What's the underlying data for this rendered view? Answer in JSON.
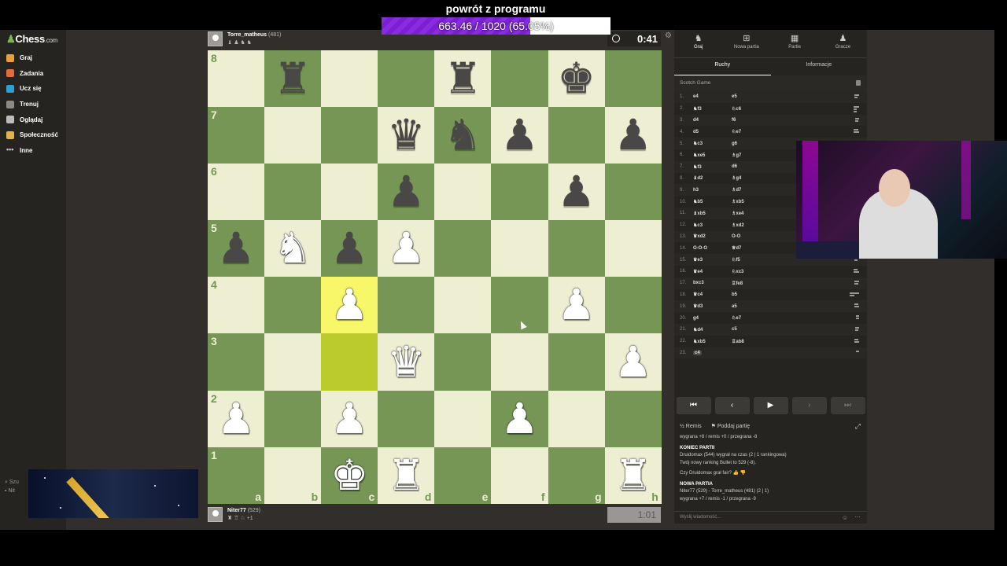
{
  "sidebar": {
    "logo": "Chess",
    "logo_suffix": ".com",
    "items": [
      {
        "label": "Graj",
        "icon": "play-icon",
        "color": "#e8a13a"
      },
      {
        "label": "Zadania",
        "icon": "puzzle-icon",
        "color": "#e36a3a"
      },
      {
        "label": "Ucz się",
        "icon": "learn-icon",
        "color": "#2b9fd6"
      },
      {
        "label": "Trenuj",
        "icon": "train-icon",
        "color": "#8d8a86"
      },
      {
        "label": "Oglądaj",
        "icon": "watch-icon",
        "color": "#bcbcbc"
      },
      {
        "label": "Społeczność",
        "icon": "community-icon",
        "color": "#ddb34a"
      },
      {
        "label": "Inne",
        "icon": "more-icon",
        "color": "#cccccc"
      }
    ],
    "bottom_search": "Szu",
    "bottom_user": "Nit"
  },
  "donation": {
    "title": "powrót z programu",
    "progress_text": "663.46 / 1020 (65.05%)",
    "progress": 0.6505
  },
  "players": {
    "top": {
      "name": "Torre_matheus",
      "rating": "(481)",
      "material": "♝ ♟ ♞ ♞",
      "clock": "0:41"
    },
    "bottom": {
      "name": "Niter77",
      "rating": "(529)",
      "material": "♜ ♖ ♘ +1",
      "clock": "1:01"
    }
  },
  "board": {
    "ranks": [
      "8",
      "7",
      "6",
      "5",
      "4",
      "3",
      "2",
      "1"
    ],
    "files": [
      "a",
      "b",
      "c",
      "d",
      "e",
      "f",
      "g",
      "h"
    ],
    "rows": [
      [
        "",
        "r",
        "",
        "",
        "r",
        "",
        "k",
        ""
      ],
      [
        "",
        "",
        "",
        "q",
        "n",
        "p",
        "",
        "p"
      ],
      [
        "",
        "",
        "",
        "p",
        "",
        "",
        "p",
        ""
      ],
      [
        "p",
        "N",
        "p",
        "P",
        "",
        "",
        "",
        ""
      ],
      [
        "",
        "",
        "P",
        "",
        "",
        "",
        "P",
        ""
      ],
      [
        "",
        "",
        "",
        "Q",
        "",
        "",
        "",
        "P"
      ],
      [
        "P",
        "",
        "P",
        "",
        "",
        "P",
        "",
        ""
      ],
      [
        "",
        "",
        "K",
        "R",
        "",
        "",
        "",
        "R"
      ]
    ],
    "highlight": [
      "c4",
      "c3"
    ]
  },
  "panel": {
    "tabs": [
      {
        "label": "Graj",
        "icon": "play-icon"
      },
      {
        "label": "Nowa partia",
        "icon": "plus-icon"
      },
      {
        "label": "Partie",
        "icon": "board-icon"
      },
      {
        "label": "Gracze",
        "icon": "players-icon"
      }
    ],
    "subtabs": [
      "Ruchy",
      "Informacje"
    ],
    "opening": "Scotch Game",
    "moves": [
      {
        "n": "1.",
        "w": "e4",
        "b": "e5"
      },
      {
        "n": "2.",
        "w": "♞f3",
        "b": "♘c6"
      },
      {
        "n": "3.",
        "w": "d4",
        "b": "f6"
      },
      {
        "n": "4.",
        "w": "d5",
        "b": "♘e7"
      },
      {
        "n": "5.",
        "w": "♞c3",
        "b": "g6"
      },
      {
        "n": "6.",
        "w": "♞xe5",
        "b": "♗g7"
      },
      {
        "n": "7.",
        "w": "♞f3",
        "b": "d6"
      },
      {
        "n": "8.",
        "w": "♝d2",
        "b": "♗g4"
      },
      {
        "n": "9.",
        "w": "h3",
        "b": "♗d7"
      },
      {
        "n": "10.",
        "w": "♞b5",
        "b": "♗xb5"
      },
      {
        "n": "11.",
        "w": "♝xb5",
        "b": "♗xe4"
      },
      {
        "n": "12.",
        "w": "♞c3",
        "b": "♗xd2"
      },
      {
        "n": "13.",
        "w": "♛xd2",
        "b": "O-O"
      },
      {
        "n": "14.",
        "w": "O-O-O",
        "b": "♕d7"
      },
      {
        "n": "15.",
        "w": "♛e3",
        "b": "♘f5"
      },
      {
        "n": "16.",
        "w": "♛e4",
        "b": "♘xc3"
      },
      {
        "n": "17.",
        "w": "bxc3",
        "b": "♖fe8"
      },
      {
        "n": "18.",
        "w": "♛c4",
        "b": "b5"
      },
      {
        "n": "19.",
        "w": "♛d3",
        "b": "a5"
      },
      {
        "n": "20.",
        "w": "g4",
        "b": "♘e7"
      },
      {
        "n": "21.",
        "w": "♞d4",
        "b": "c5"
      },
      {
        "n": "22.",
        "w": "♞xb5",
        "b": "♖ab8"
      },
      {
        "n": "23.",
        "w": "c4",
        "b": ""
      }
    ],
    "actions": {
      "draw": "Remis",
      "resign": "Poddaj partię"
    },
    "chat": {
      "line1": "wygrana +8 / remis +0 / przegrana -8",
      "end_title": "KONIEC PARTII",
      "end_text": "Druidomax (544) wygrał na czas (2 | 1 rankingowa)",
      "rating_text": "Twój nowy ranking Bullet to 529 (-8).",
      "fair": "Czy Druidomax grał fair?",
      "new_title": "NOWA PARTIA",
      "new_text": "Niter77 (529) - Torre_matheus (481) (2 | 1)",
      "new_odds": "wygrana +7 / remis -1 / przegrana -9",
      "placeholder": "Wyślij wiadomość..."
    }
  }
}
